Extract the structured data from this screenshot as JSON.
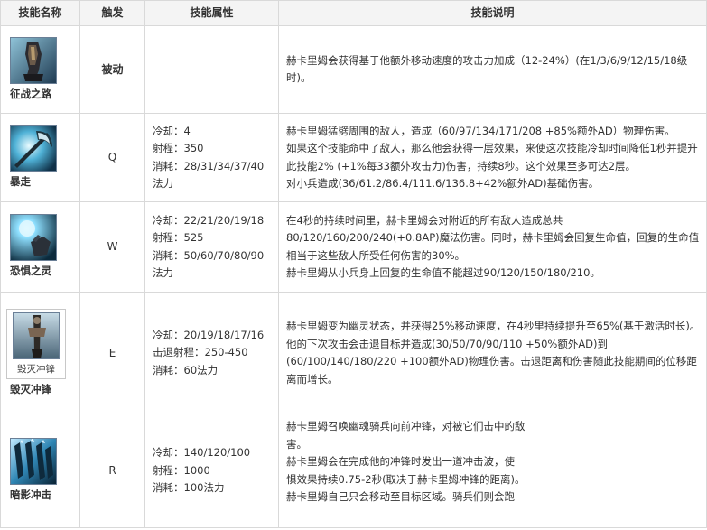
{
  "headers": [
    "技能名称",
    "触发",
    "技能属性",
    "技能说明"
  ],
  "skills": [
    {
      "name": "征战之路",
      "trigger": "被动",
      "attrs": [],
      "desc": [
        "赫卡里姆会获得基于他额外移动速度的攻击力加成（12-24%）(在1/3/6/9/12/15/18级时)。"
      ],
      "icon": "warhorse-arm-icon"
    },
    {
      "name": "暴走",
      "trigger": "Q",
      "attrs": [
        "冷却：4",
        "射程：350",
        "消耗：28/31/34/37/40",
        "法力"
      ],
      "desc": [
        "赫卡里姆猛劈周围的敌人，造成（60/97/134/171/208 +85%额外AD）物理伤害。",
        "如果这个技能命中了敌人，那么他会获得一层效果，来使这次技能冷却时间降低1秒并提升此技能2% (+1%每33额外攻击力)伤害，持续8秒。这个效果至多可达2层。",
        "对小兵造成(36/61.2/86.4/111.6/136.8+42%额外AD)基础伤害。"
      ],
      "icon": "halberd-icon"
    },
    {
      "name": "恐惧之灵",
      "trigger": "W",
      "attrs": [
        "冷却：22/21/20/19/18",
        "射程：525",
        "消耗：50/60/70/80/90",
        "法力"
      ],
      "desc": [
        "在4秒的持续时间里，赫卡里姆会对附近的所有敌人造成总共80/120/160/200/240(+0.8AP)魔法伤害。同时，赫卡里姆会回复生命值，回复的生命值相当于这些敌人所受任何伤害的30%。",
        "赫卡里姆从小兵身上回复的生命值不能超过90/120/150/180/210。"
      ],
      "icon": "spirit-orb-hand-icon"
    },
    {
      "name": "毁灭冲锋",
      "trigger": "E",
      "attrs": [
        "冷却：20/19/18/17/16",
        "击退射程：250-450",
        "消耗：60法力"
      ],
      "desc": [
        "赫卡里姆变为幽灵状态，并获得25%移动速度，在4秒里持续提升至65%(基于激活时长)。他的下次攻击会击退目标并造成(30/50/70/90/110 +50%额外AD)到(60/100/140/180/220 +100额外AD)物理伤害。击退距离和伤害随此技能期间的位移距离而增长。"
      ],
      "icon": "lance-icon",
      "icon_caption": "毁灭冲锋"
    },
    {
      "name": "暗影冲击",
      "trigger": "R",
      "attrs": [
        "冷却：140/120/100",
        "射程：1000",
        "消耗：100法力"
      ],
      "desc": [
        "赫卡里姆召唤幽魂骑兵向前冲锋，对被它们击中的敌",
        "害。",
        "赫卡里姆会在完成他的冲锋时发出一道冲击波，使",
        "惧效果持续0.75-2秒(取决于赫卡里姆冲锋的距离)。",
        "赫卡里姆自己只会移动至目标区域。骑兵们则会跑"
      ],
      "icon": "spectral-riders-icon"
    }
  ],
  "colors": {
    "header_bg": "#f4f4f4",
    "border": "#d9d9d9",
    "text": "#333333"
  }
}
